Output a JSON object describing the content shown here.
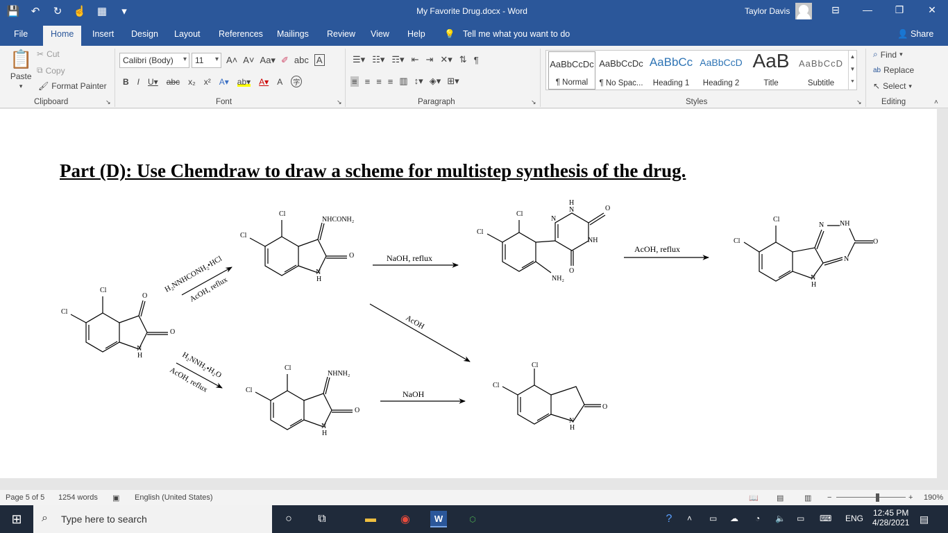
{
  "titlebar": {
    "document_title": "My Favorite Drug.docx  -  Word",
    "user_name": "Taylor Davis"
  },
  "tabs": [
    "File",
    "Home",
    "Insert",
    "Design",
    "Layout",
    "References",
    "Mailings",
    "Review",
    "View",
    "Help"
  ],
  "tell_me": "Tell me what you want to do",
  "share": "Share",
  "clipboard": {
    "paste": "Paste",
    "cut": "Cut",
    "copy": "Copy",
    "format_painter": "Format Painter",
    "label": "Clipboard"
  },
  "font": {
    "family": "Calibri (Body)",
    "size": "11",
    "label": "Font"
  },
  "paragraph": {
    "label": "Paragraph"
  },
  "styles": {
    "label": "Styles",
    "items": [
      {
        "preview": "AaBbCcDc",
        "name": "¶ Normal"
      },
      {
        "preview": "AaBbCcDc",
        "name": "¶ No Spac..."
      },
      {
        "preview": "AaBbCc",
        "name": "Heading 1"
      },
      {
        "preview": "AaBbCcD",
        "name": "Heading 2"
      },
      {
        "preview": "AaB",
        "name": "Title"
      },
      {
        "preview": "AaBbCcD",
        "name": "Subtitle"
      }
    ]
  },
  "editing": {
    "find": "Find",
    "replace": "Replace",
    "select": "Select",
    "label": "Editing"
  },
  "document": {
    "heading": "Part (D): Use Chemdraw to draw a scheme for multistep synthesis of the drug.",
    "scheme": {
      "reagents_top": "H₂NNHCONH₂•HCl",
      "conditions_top": "AcOH, reflux",
      "reagents_bottom": "H₂NNH₂•H₂O",
      "conditions_bottom": "AcOH, reflux",
      "arrow_naoh_reflux": "NaOH, reflux",
      "arrow_acoh_reflux": "AcOH, reflux",
      "arrow_acoh": "AcOH",
      "arrow_naoh": "NaOH",
      "substituent_semicarbazone": "NHCONH₂",
      "substituent_hydrazone": "NHNH₂",
      "substituent_amine": "NH₂"
    }
  },
  "status": {
    "page": "Page 5 of 5",
    "words": "1254 words",
    "language": "English (United States)",
    "zoom": "190%"
  },
  "taskbar": {
    "search_placeholder": "Type here to search",
    "lang": "ENG",
    "time": "12:45 PM",
    "date": "4/28/2021"
  }
}
